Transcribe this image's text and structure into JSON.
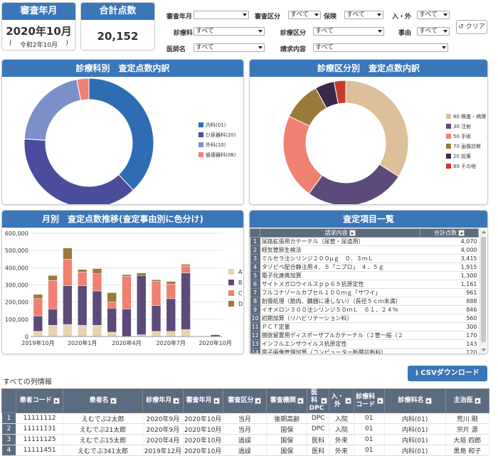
{
  "kpi": {
    "review_month": {
      "title": "審査年月",
      "value": "2020年10月",
      "sub_open": "(",
      "sub": "令和2年10月",
      "sub_close": ")"
    },
    "total_points": {
      "title": "合計点数",
      "value": "20,152"
    }
  },
  "filters": {
    "review_month": {
      "label": "審査年月",
      "value": ""
    },
    "review_type": {
      "label": "審査区分",
      "value": "すべて"
    },
    "insurance": {
      "label": "保険",
      "value": "すべて"
    },
    "in_out": {
      "label": "入・外",
      "value": "すべて"
    },
    "department": {
      "label": "診療科",
      "value": "すべて"
    },
    "medical_type": {
      "label": "診療区分",
      "value": "すべて"
    },
    "reason": {
      "label": "事由",
      "value": "すべて"
    },
    "doctor": {
      "label": "医師名",
      "value": "すべて"
    },
    "claim_content": {
      "label": "請求内容",
      "value": "すべて"
    },
    "clear_label": "クリア"
  },
  "panels": {
    "dept_breakdown": {
      "title": "診療科別　査定点数内訳",
      "chart_data": {
        "type": "pie",
        "donut": true,
        "labels": [
          "内科(01)",
          "ひ尿器科(20)",
          "外科(10)",
          "循環器科(08)"
        ],
        "values": [
          38,
          38,
          21,
          3
        ],
        "colors": [
          "#2e6db4",
          "#4a4c9c",
          "#7b8fc9",
          "#f08070"
        ],
        "legend": "right"
      }
    },
    "category_breakdown": {
      "title": "診療区分別　査定点数内訳",
      "chart_data": {
        "type": "pie",
        "donut": true,
        "labels": [
          "60 検査・病理",
          "30 注射",
          "50 手術",
          "70 画像診断",
          "20 投薬",
          "80 その他"
        ],
        "values": [
          34,
          26,
          22,
          10,
          5,
          3
        ],
        "colors": [
          "#dcc09a",
          "#5c4a7a",
          "#f08070",
          "#9a7a3a",
          "#3a2a4a",
          "#c83a2a"
        ],
        "legend": "right"
      }
    },
    "monthly": {
      "title": "月別　査定点数推移(査定事由別に色分け)",
      "chart_data": {
        "type": "bar",
        "stacked": true,
        "categories": [
          "2019年10月",
          "2019年11月",
          "2019年12月",
          "2020年1月",
          "2020年2月",
          "2020年3月",
          "2020年4月",
          "2020年5月",
          "2020年6月",
          "2020年7月",
          "2020年8月",
          "2020年9月",
          "2020年10月"
        ],
        "x_tick_labels": [
          "2019年10月",
          "2020年1月",
          "2020年4月",
          "2020年7月",
          "2020年10月"
        ],
        "series": [
          {
            "name": "A",
            "color": "#e8d3b0",
            "values": [
              30000,
              65000,
              70000,
              65000,
              65000,
              25000,
              0,
              10000,
              30000,
              30000,
              40000,
              0,
              0
            ]
          },
          {
            "name": "B",
            "color": "#5c4a7a",
            "values": [
              90000,
              95000,
              225000,
              230000,
              200000,
              140000,
              160000,
              345000,
              150000,
              190000,
              330000,
              0,
              10000
            ]
          },
          {
            "name": "C",
            "color": "#f08070",
            "values": [
              100000,
              165000,
              155000,
              80000,
              100000,
              35000,
              190000,
              0,
              140000,
              85000,
              40000,
              0,
              0
            ]
          },
          {
            "name": "D",
            "color": "#9a7a3a",
            "values": [
              25000,
              30000,
              65000,
              15000,
              30000,
              55000,
              10000,
              15000,
              10000,
              15000,
              10000,
              0,
              0
            ]
          }
        ],
        "ylim": [
          0,
          600000
        ],
        "yticks": [
          "0",
          "100,000",
          "200,000",
          "300,000",
          "400,000",
          "500,000",
          "600,000"
        ],
        "legend": "right"
      }
    },
    "items": {
      "title": "査定項目一覧",
      "columns": [
        "請求内容",
        "合計点数"
      ],
      "rows": [
        [
          "尿路拡張用カテーテル（尿管・尿道用）",
          "4,070"
        ],
        [
          "経気管肺生検法",
          "4,000"
        ],
        [
          "ミルセラ注シリンジ２００μｇ　０．３ｍＬ",
          "3,415"
        ],
        [
          "タゾピペ配合静注用４．５「ニプロ」　４．５ｇ",
          "1,915"
        ],
        [
          "電子化連携加算",
          "1,300"
        ],
        [
          "サイトメガロウイルスｐｐ６５抗原定性",
          "1,161"
        ],
        [
          "フルコナゾールカプセル１００ｍｇ「サワイ」",
          "961"
        ],
        [
          "創傷処理（筋肉、臓器に達しない）（長径５ｃｍ未満）",
          "888"
        ],
        [
          "イオメロン３００注シリンジ５０ｍＬ　６１．２４％",
          "846"
        ],
        [
          "初期加算（リハビリテーション料）",
          "560"
        ],
        [
          "ＰＣＴ定量",
          "300"
        ],
        [
          "膀胱留置用ディスポーザブルカテーテル（２管一般（２",
          "170"
        ],
        [
          "インフルエンザウイルス抗原定性",
          "143"
        ],
        [
          "電子画像管理加算（コンピューター断層診断料）",
          "120"
        ]
      ]
    }
  },
  "table": {
    "title": "すべての列情報",
    "csv_label": "CSVダウンロード",
    "columns": [
      "患者コード",
      "患者名",
      "診療年月",
      "審査年月",
      "審査区分",
      "審査機関",
      "医科DPC",
      "入・外",
      "診療科コード",
      "診療科名",
      "主治医"
    ],
    "rows": [
      [
        "1",
        "11111112",
        "えむでぶ2太郎",
        "2020年9月",
        "2020年10月",
        "当月",
        "後期高齢",
        "DPC",
        "入院",
        "01",
        "内科(01)",
        "荒川 剛"
      ],
      [
        "2",
        "11111131",
        "えむでぶ21太郎",
        "2020年9月",
        "2020年10月",
        "当月",
        "国保",
        "DPC",
        "入院",
        "01",
        "内科(01)",
        "宗片 源"
      ],
      [
        "3",
        "11111125",
        "えむでぶ15太郎",
        "2020年4月",
        "2020年10月",
        "過誤",
        "国保",
        "医科",
        "外来",
        "01",
        "内科(01)",
        "大垣 四郎"
      ],
      [
        "4",
        "11111451",
        "えむでぶ341太郎",
        "2019年12月",
        "2020年10月",
        "過誤",
        "国保",
        "医科",
        "外来",
        "01",
        "内科(01)",
        "黒島 和子"
      ]
    ]
  }
}
